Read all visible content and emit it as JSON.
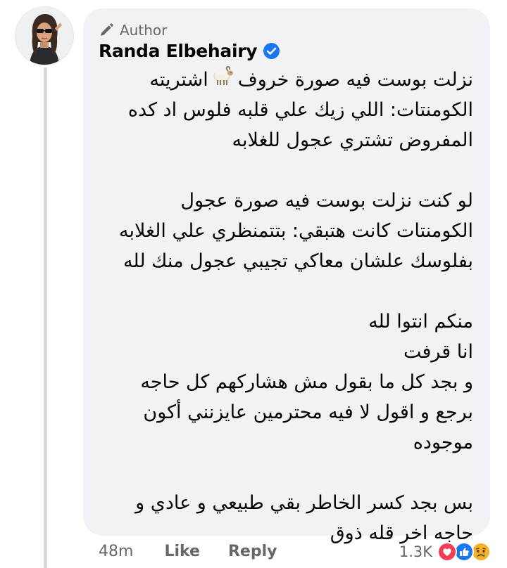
{
  "comment": {
    "author_badge": "Author",
    "author_name": "Randa Elbehairy",
    "lines": [
      {
        "type": "text",
        "before": "نزلت بوست فيه صورة خروف",
        "emoji": "ram-emoji",
        "after": "اشتريته"
      },
      {
        "type": "text",
        "text": "الكومنتات: اللي زيك علي قلبه فلوس اد كده"
      },
      {
        "type": "text",
        "text": "المفروض تشتري عجول للغلابه"
      },
      {
        "type": "gap"
      },
      {
        "type": "text",
        "text": "لو كنت نزلت بوست فيه صورة عجول"
      },
      {
        "type": "text",
        "text": "الكومنتات كانت هتبقي: بتتمنظري علي الغلابه"
      },
      {
        "type": "text",
        "text": "بفلوسك علشان معاكي تجيبي عجول منك لله"
      },
      {
        "type": "gap"
      },
      {
        "type": "text",
        "text": "منكم انتوا لله"
      },
      {
        "type": "text",
        "text": "انا قرفت"
      },
      {
        "type": "text",
        "text": "و بجد كل ما بقول مش هشاركهم كل حاجه"
      },
      {
        "type": "text",
        "text": "برجع و اقول لا فيه محترمين عايزنني أكون"
      },
      {
        "type": "text",
        "text": "موجوده"
      },
      {
        "type": "gap"
      },
      {
        "type": "text",
        "text": "بس بجد كسر الخاطر بقي طبيعي و عادي و"
      },
      {
        "type": "text",
        "text": "حاجه اخر قله ذوق"
      }
    ],
    "time": "48m",
    "like_label": "Like",
    "reply_label": "Reply",
    "reaction_count": "1.3K",
    "reaction_icons": [
      "love-icon",
      "like-icon",
      "sad-icon"
    ]
  },
  "colors": {
    "bubble_bg": "#f0f2f5",
    "meta_text": "#65676b",
    "verified_blue": "#1877f2",
    "love_red": "#f33e58",
    "sad_yellow": "#f7b125"
  }
}
